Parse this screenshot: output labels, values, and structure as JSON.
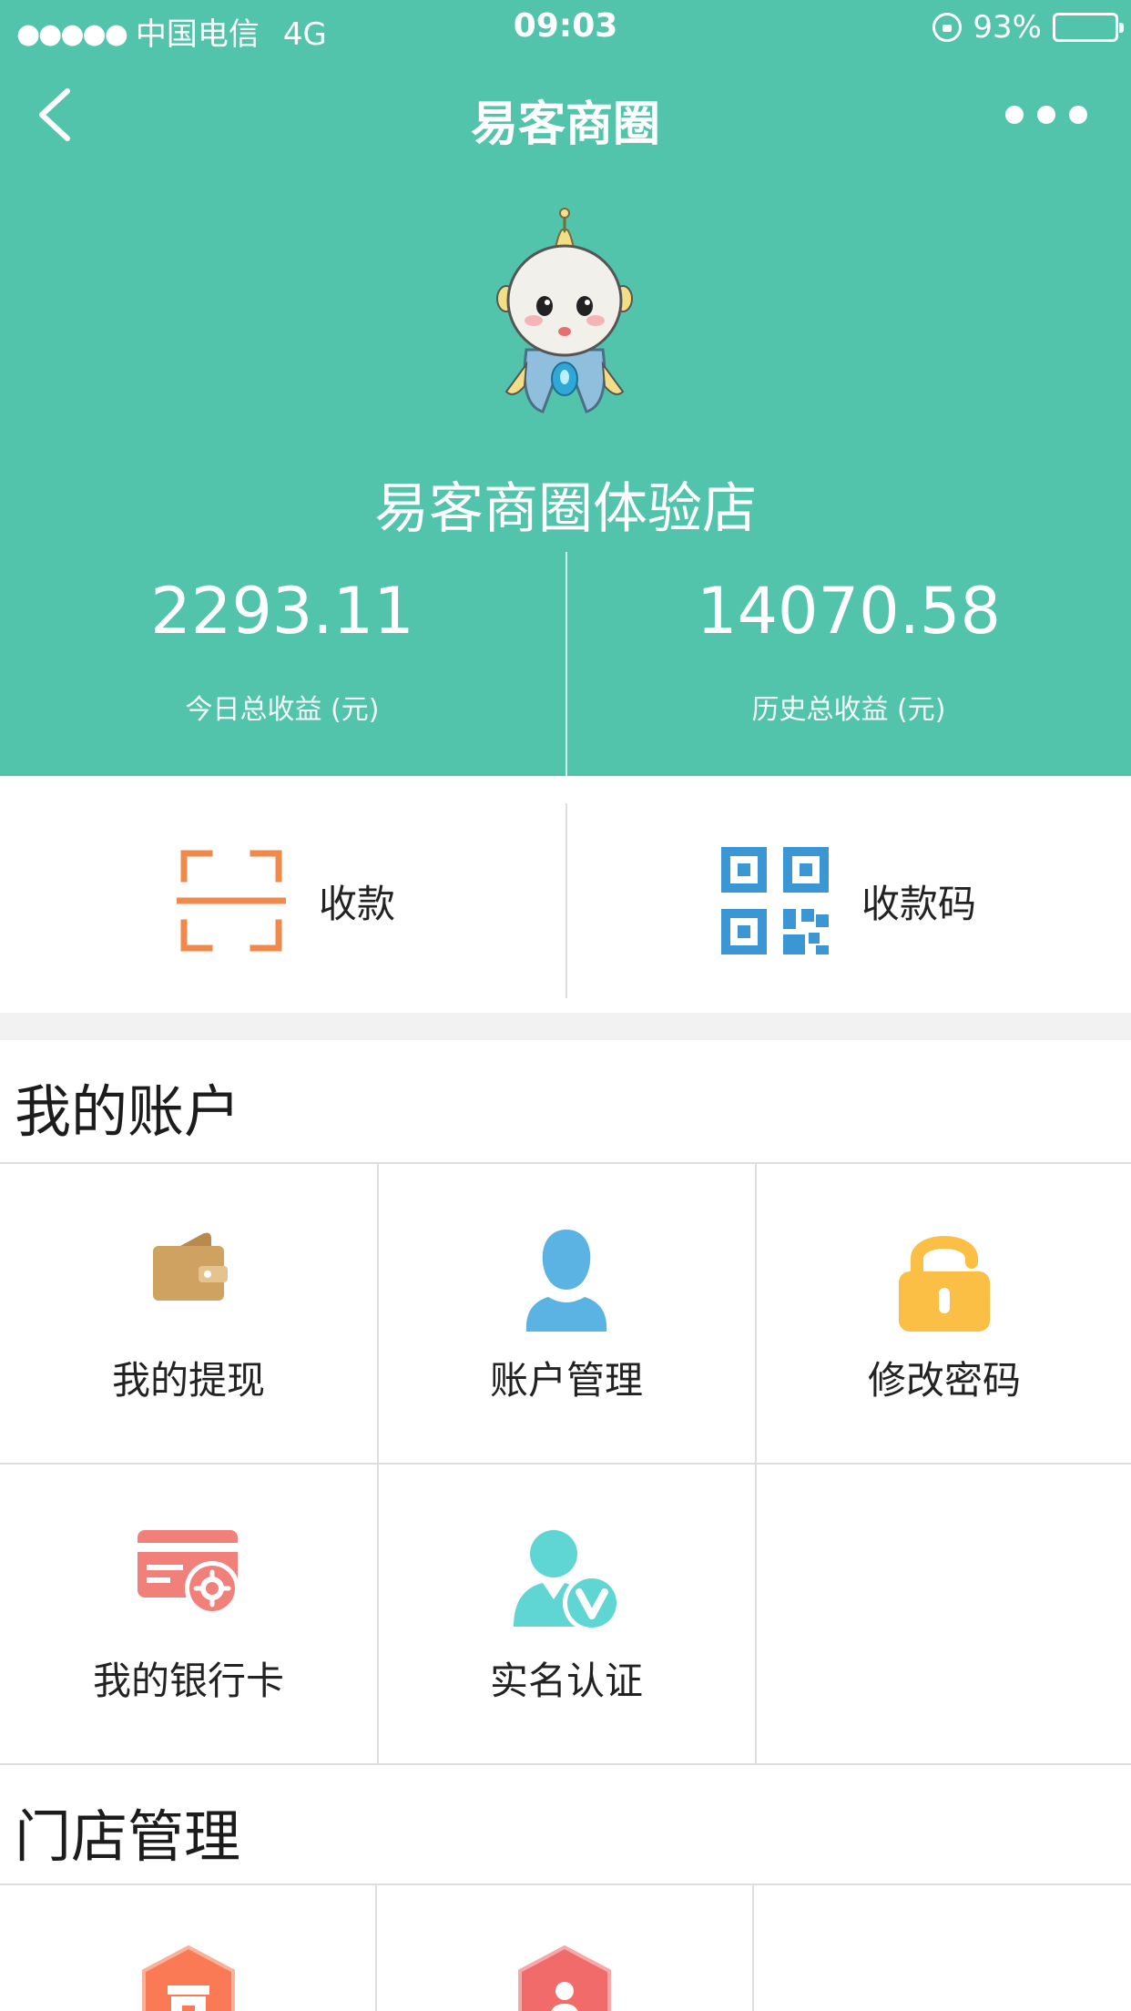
{
  "status_bar": {
    "signal": "●●●●●",
    "carrier": "中国电信",
    "network": "4G",
    "time": "09:03",
    "battery": "93%"
  },
  "nav": {
    "title": "易客商圈"
  },
  "shop": {
    "name": "易客商圈体验店"
  },
  "stats": {
    "today_value": "2293.11",
    "today_label": "今日总收益 (元)",
    "history_value": "14070.58",
    "history_label": "历史总收益 (元)"
  },
  "quick_actions": {
    "collect_label": "收款",
    "collect_icon": "scan-icon",
    "collect_color": "#f08a4b",
    "qrcode_label": "收款码",
    "qrcode_icon": "qrcode-icon",
    "qrcode_color": "#3a97d4"
  },
  "account": {
    "title": "我的账户",
    "items": [
      {
        "label": "我的提现",
        "icon": "wallet-icon",
        "color": "#cfa262"
      },
      {
        "label": "账户管理",
        "icon": "user-icon",
        "color": "#5bb3e3"
      },
      {
        "label": "修改密码",
        "icon": "unlock-icon",
        "color": "#fbbf45"
      },
      {
        "label": "我的银行卡",
        "icon": "bank-card-icon",
        "color": "#f2807a"
      },
      {
        "label": "实名认证",
        "icon": "verified-user-icon",
        "color": "#5fd6d4"
      }
    ]
  },
  "store": {
    "title": "门店管理",
    "items": [
      {
        "icon": "store-icon",
        "color": "#f97a55"
      },
      {
        "icon": "staff-icon",
        "color": "#f26b6b"
      }
    ]
  },
  "colors": {
    "brand_teal": "#52c4ac",
    "background_gray": "#f2f2f2"
  }
}
